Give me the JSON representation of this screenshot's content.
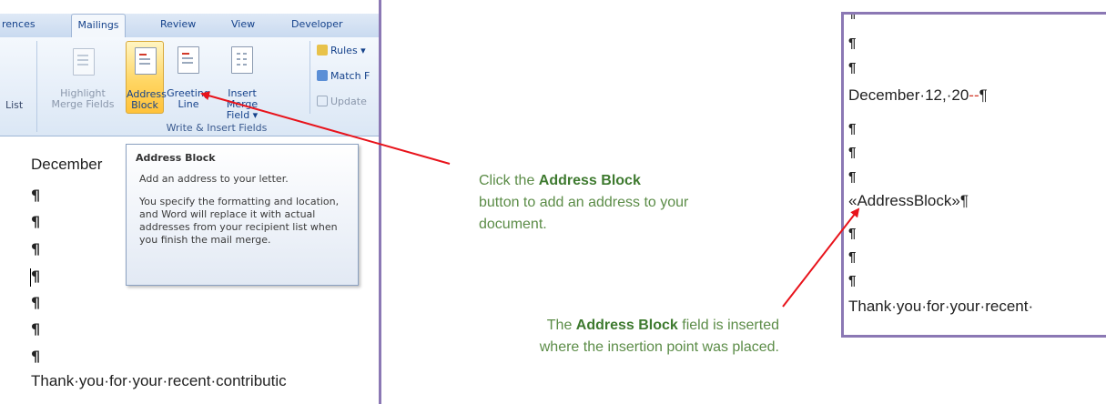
{
  "ribbon": {
    "tabs": [
      "rences",
      "Mailings",
      "Review",
      "View",
      "Developer"
    ],
    "active_tab": "Mailings",
    "list_label": "List",
    "buttons": {
      "highlight_merge_fields": {
        "line1": "Highlight",
        "line2": "Merge Fields"
      },
      "address_block": {
        "line1": "Address",
        "line2": "Block"
      },
      "greeting_line": {
        "line1": "Greeting",
        "line2": "Line"
      },
      "insert_merge_field": {
        "line1": "Insert Merge",
        "line2": "Field ▾"
      },
      "rules": "Rules ▾",
      "match_fields": "Match F",
      "update": "Update"
    },
    "group_label": "Write & Insert Fields"
  },
  "tooltip": {
    "title": "Address Block",
    "line1": "Add an address to your letter.",
    "line2": "You specify the formatting and location, and Word will replace it with actual addresses from your recipient list when you finish the mail merge."
  },
  "left_doc": {
    "date_partial": "December",
    "pilcrow": "¶",
    "closing_partial": "Thank·you·for·your·recent·contributic"
  },
  "captions": {
    "top": {
      "before": "Click the ",
      "bold": "Address Block",
      "after": " button to add an address to your document."
    },
    "bottom": {
      "before": "The ",
      "bold": "Address Block",
      "after": " field is inserted where the insertion point was placed."
    }
  },
  "right_doc": {
    "pilcrow": "¶",
    "date_text": "December·12,·20",
    "date_dashes": "--",
    "address_field": "«AddressBlock»¶",
    "closing_partial": "Thank·you·for·your·recent·"
  },
  "colors": {
    "panel_border": "#8b78b4",
    "caption_green": "#5b8c47",
    "arrow_red": "#e8131b",
    "highlight_button": "#ffd664"
  }
}
